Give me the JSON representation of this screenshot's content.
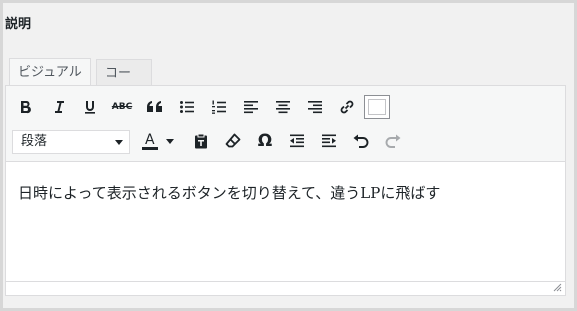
{
  "field": {
    "label": "説明"
  },
  "tabs": {
    "visual": "ビジュアル",
    "code": "コード"
  },
  "toolbar": {
    "row1": [
      "bold-icon",
      "italic-icon",
      "underline-icon",
      "strikethrough-icon",
      "blockquote-icon",
      "bullet-list-icon",
      "numbered-list-icon",
      "align-left-icon",
      "align-center-icon",
      "align-right-icon",
      "link-icon",
      "toolbar-toggle-icon"
    ],
    "row2": [
      "text-color-icon",
      "paste-text-icon",
      "clear-formatting-icon",
      "special-character-icon",
      "outdent-icon",
      "indent-icon",
      "undo-icon",
      "redo-icon"
    ],
    "format_value": "段落",
    "text_color_letter": "A",
    "abc": "ABC",
    "omega": "Ω"
  },
  "editor": {
    "content": "日時によって表示されるボタンを切り替えて、違うLPに飛ばす"
  },
  "colors": {
    "text_color_swatch": "#1d2327",
    "disabled": "#a7aaad"
  }
}
